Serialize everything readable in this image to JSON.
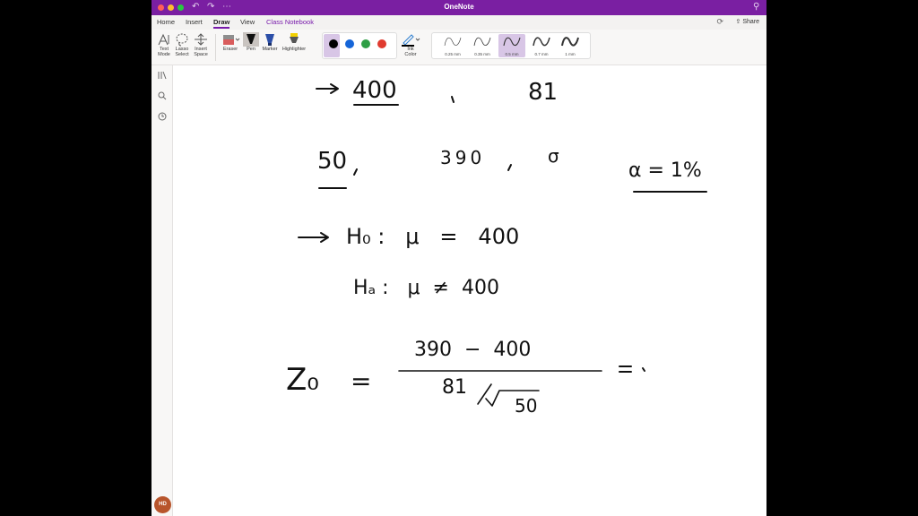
{
  "app": {
    "title": "OneNote",
    "tabs": [
      {
        "label": "Home"
      },
      {
        "label": "Insert"
      },
      {
        "label": "Draw"
      },
      {
        "label": "View"
      },
      {
        "label": "Class Notebook"
      }
    ],
    "share_label": "Share",
    "user_initials": "HD"
  },
  "ribbon": {
    "tools": [
      {
        "label_1": "Text",
        "label_2": "Mode"
      },
      {
        "label_1": "Lasso",
        "label_2": "Select"
      },
      {
        "label_1": "Insert",
        "label_2": "Space"
      }
    ],
    "eraser_label": "Eraser",
    "pen_label": "Pen",
    "marker_label": "Marker",
    "highlighter_label": "Highlighter",
    "colors": [
      "#000000",
      "#1565d8",
      "#2e9e45",
      "#e03b2f"
    ],
    "ink_color_label_1": "Ink",
    "ink_color_label_2": "Color",
    "strokes": [
      {
        "label": "0.25 mm"
      },
      {
        "label": "0.35 mm"
      },
      {
        "label": "0.5 mm"
      },
      {
        "label": "0.7 mm"
      },
      {
        "label": "1 mm"
      }
    ]
  },
  "note": {
    "line1_value1": "400",
    "line1_value2": "81",
    "line2_n": "50",
    "line2_xbar": "390",
    "line2_sigma": "σ",
    "alpha": "α = 1%",
    "h0": "H₀ :   μ   =   400",
    "ha": "Hₐ :   μ  ≠  400",
    "z0_label": "Z₀",
    "numerator": "390  −  400",
    "den_sigma": "81",
    "den_sqrt_n": "50"
  }
}
